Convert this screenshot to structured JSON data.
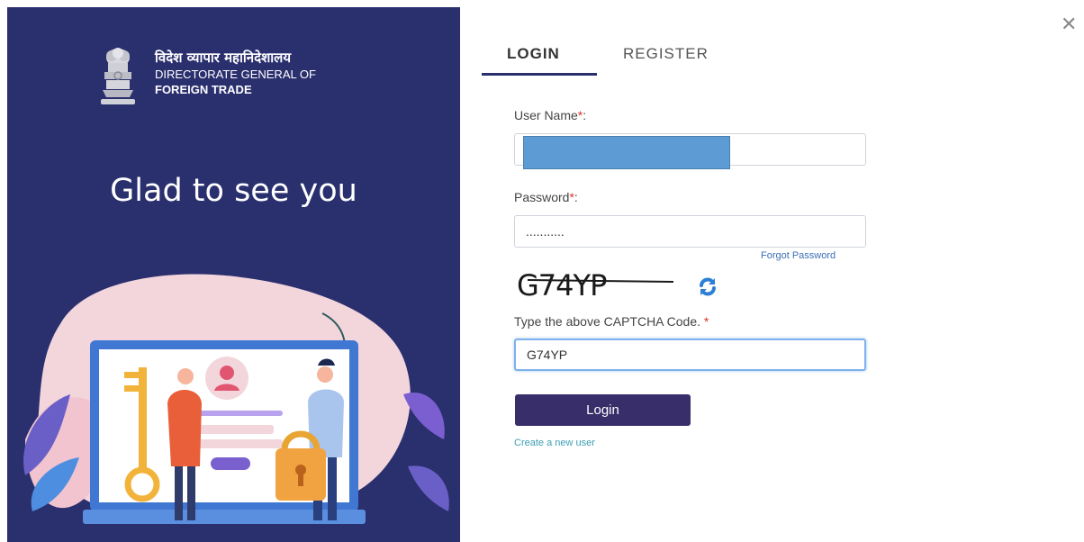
{
  "header": {
    "close_glyph": "✕"
  },
  "brand": {
    "hindi": "विदेश व्यापार महानिदेशालय",
    "line1": "DIRECTORATE GENERAL OF",
    "line2": "FOREIGN TRADE",
    "emblem_icon": "national-emblem-icon"
  },
  "left_panel": {
    "greeting": "Glad to see you",
    "bg_color": "#2a2f6e"
  },
  "tabs": [
    {
      "label": "LOGIN",
      "active": true
    },
    {
      "label": "REGISTER",
      "active": false
    }
  ],
  "form": {
    "username": {
      "label": "User Name",
      "required_mark": "*",
      "suffix": ":",
      "value": ""
    },
    "password": {
      "label": "Password",
      "required_mark": "*",
      "suffix": ":",
      "value": "..........."
    },
    "forgot_password": "Forgot Password",
    "captcha": {
      "image_text": "G74YP",
      "refresh_icon": "refresh-icon"
    },
    "captcha_input": {
      "label": "Type the above CAPTCHA Code.",
      "required_mark": "*",
      "value": "G74YP"
    },
    "login_button": "Login",
    "create_user": "Create a new user"
  },
  "colors": {
    "accent": "#372e6a",
    "link": "#3b6fb6",
    "required": "#d9352d"
  }
}
